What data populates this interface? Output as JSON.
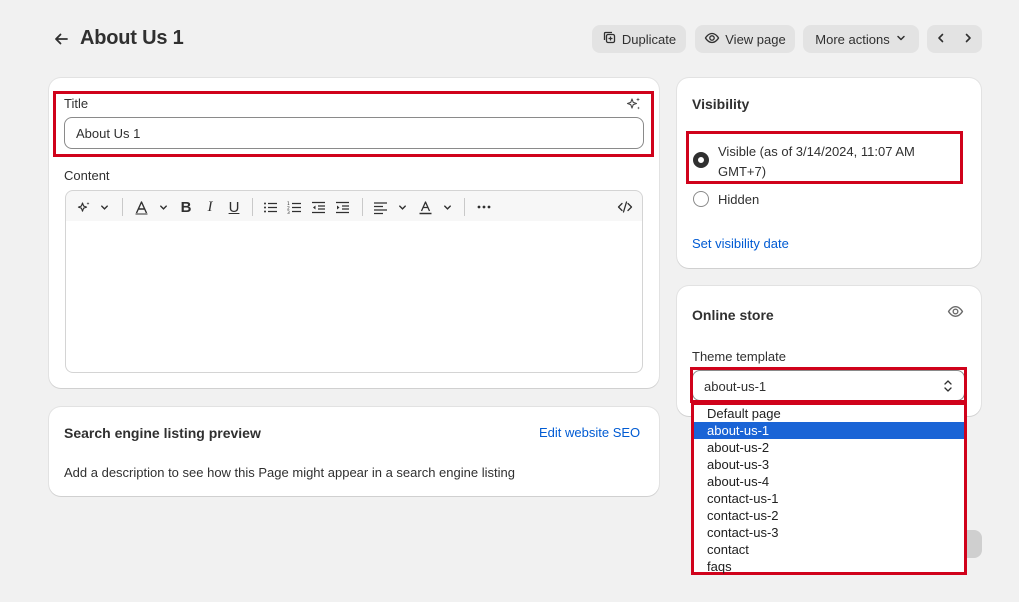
{
  "header": {
    "title": "About Us 1",
    "duplicate_label": "Duplicate",
    "view_page_label": "View page",
    "more_actions_label": "More actions"
  },
  "title_field": {
    "label": "Title",
    "value": "About Us 1"
  },
  "content": {
    "label": "Content"
  },
  "seo": {
    "heading": "Search engine listing preview",
    "edit_link": "Edit website SEO",
    "description": "Add a description to see how this Page might appear in a search engine listing"
  },
  "visibility": {
    "heading": "Visibility",
    "visible_label_line1": "Visible (as of 3/14/2024, 11:07 AM",
    "visible_label_line2": "GMT+7)",
    "hidden_label": "Hidden",
    "set_date_link": "Set visibility date",
    "selected": "visible"
  },
  "online_store": {
    "heading": "Online store",
    "template_label": "Theme template",
    "template_value": "about-us-1",
    "options": [
      "Default page",
      "about-us-1",
      "about-us-2",
      "about-us-3",
      "about-us-4",
      "contact-us-1",
      "contact-us-2",
      "contact-us-3",
      "contact",
      "faqs"
    ],
    "selected_index": 1
  },
  "colors": {
    "accent_link": "#005bd3",
    "highlight": "#d0021b",
    "selected_option": "#1a64d6"
  }
}
